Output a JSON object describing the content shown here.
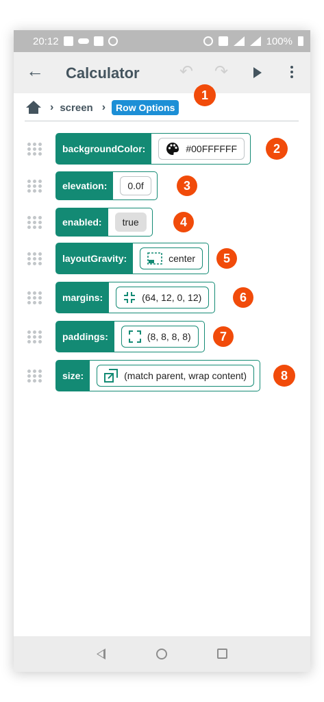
{
  "status_bar": {
    "time": "20:12",
    "battery": "100%"
  },
  "app_bar": {
    "title": "Calculator"
  },
  "breadcrumb": {
    "items": [
      "screen"
    ],
    "active": "Row Options"
  },
  "rows": [
    {
      "label": "backgroundColor:",
      "value": "#00FFFFFF",
      "icon": "palette-icon",
      "badge": "2"
    },
    {
      "label": "elevation:",
      "value": "0.0f",
      "icon": "",
      "badge": "3"
    },
    {
      "label": "enabled:",
      "value": "true",
      "icon": "",
      "badge": "4"
    },
    {
      "label": "layoutGravity:",
      "value": "center",
      "icon": "gravity-icon",
      "badge": "5"
    },
    {
      "label": "margins:",
      "value": "(64, 12, 0, 12)",
      "icon": "margins-icon",
      "badge": "6"
    },
    {
      "label": "paddings:",
      "value": "(8, 8, 8, 8)",
      "icon": "paddings-icon",
      "badge": "7"
    },
    {
      "label": "size:",
      "value": "(match parent, wrap content)",
      "icon": "size-icon",
      "badge": "8"
    }
  ],
  "badges": {
    "breadcrumb": "1"
  },
  "colors": {
    "accent": "#138a74",
    "badge": "#f14b0a",
    "breadcrumb_active": "#1d8fd6"
  }
}
